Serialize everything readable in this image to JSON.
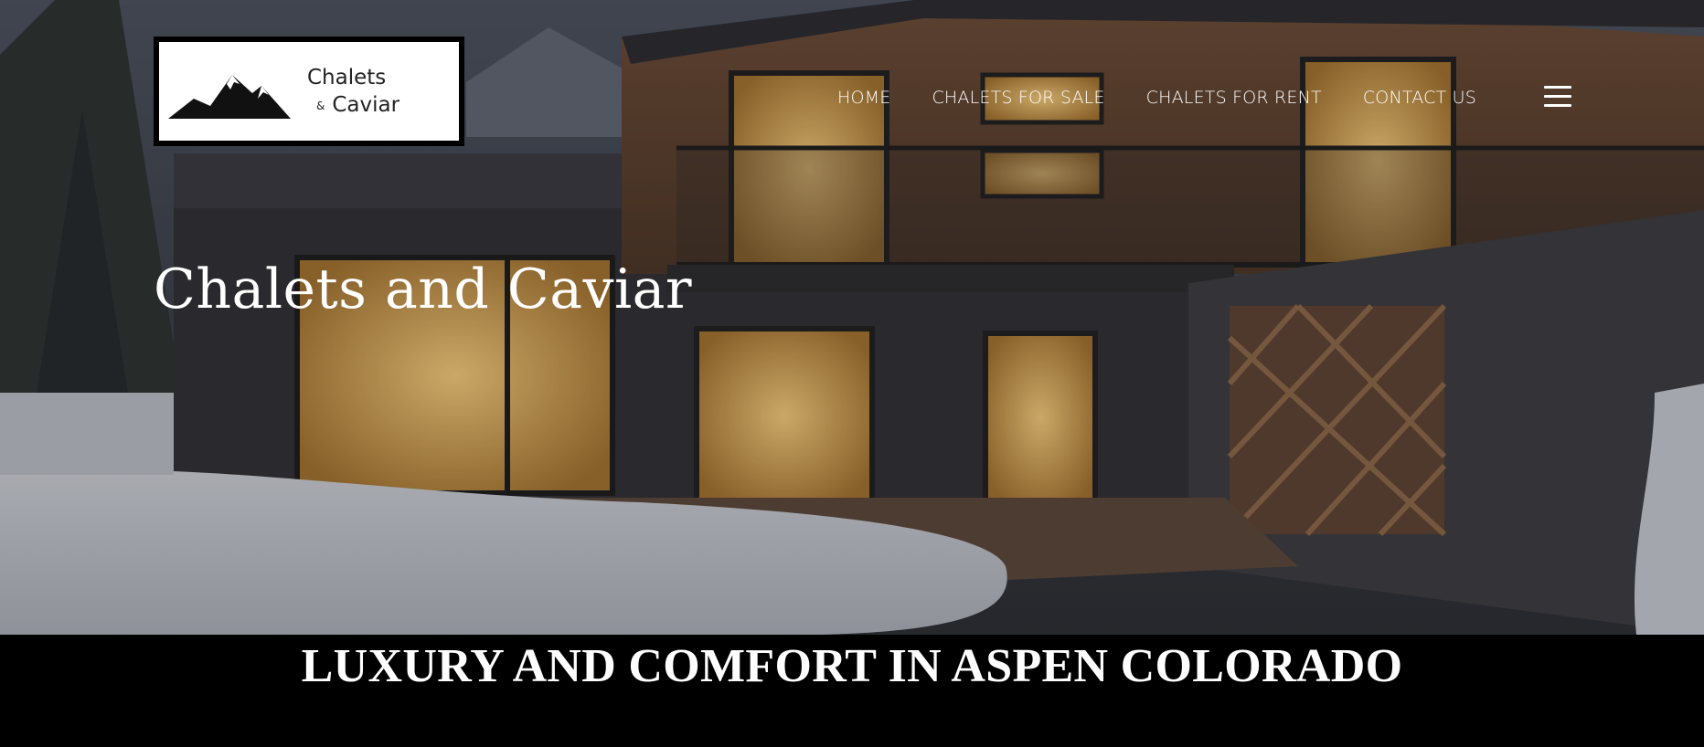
{
  "logo": {
    "line1": "Chalets",
    "amp": "&",
    "line2": "Caviar"
  },
  "nav": {
    "items": [
      {
        "label": "HOME"
      },
      {
        "label": "CHALETS FOR SALE"
      },
      {
        "label": "CHALETS FOR RENT"
      },
      {
        "label": "CONTACT US"
      }
    ],
    "menu_icon": "hamburger-menu-icon"
  },
  "hero": {
    "title": "Chalets and Caviar",
    "image": "chalet-exterior-photo"
  },
  "tagline": "LUXURY AND COMFORT IN ASPEN COLORADO",
  "colors": {
    "band_background": "#000000",
    "text": "#ffffff"
  }
}
